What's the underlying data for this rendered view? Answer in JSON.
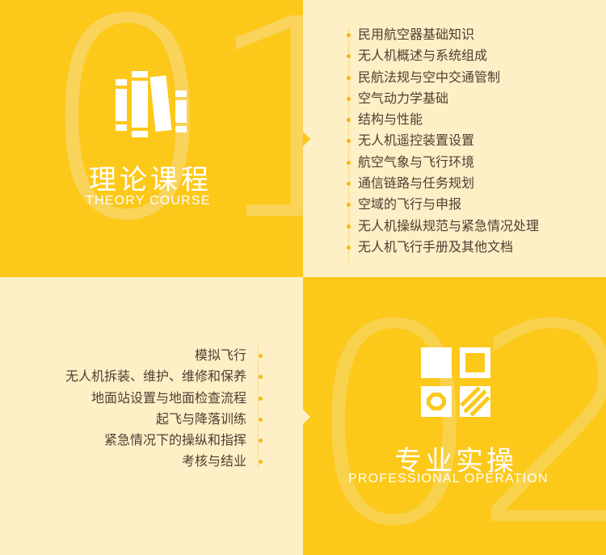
{
  "theory": {
    "number": "01",
    "title_cn": "理论课程",
    "title_en": "THEORY COURSE",
    "icon": "books-icon",
    "items": [
      "民用航空器基础知识",
      "无人机概述与系统组成",
      "民航法规与空中交通管制",
      "空气动力学基础",
      "结构与性能",
      "无人机遥控装置设置",
      "航空气象与飞行环境",
      "通信链路与任务规划",
      "空域的飞行与申报",
      "无人机操纵规范与紧急情况处理",
      "无人机飞行手册及其他文档"
    ]
  },
  "practice": {
    "number": "02",
    "title_cn": "专业实操",
    "title_en": "PROFESSIONAL OPERATION",
    "icon": "grid-tiles-icon",
    "items": [
      "模拟飞行",
      "无人机拆装、维护、维修和保养",
      "地面站设置与地面检查流程",
      "起飞与降落训练",
      "紧急情况下的操纵和指挥",
      "考核与结业"
    ]
  },
  "colors": {
    "yellow": "#fcc81a",
    "cream": "#fdefc6",
    "text": "#4d4033"
  }
}
